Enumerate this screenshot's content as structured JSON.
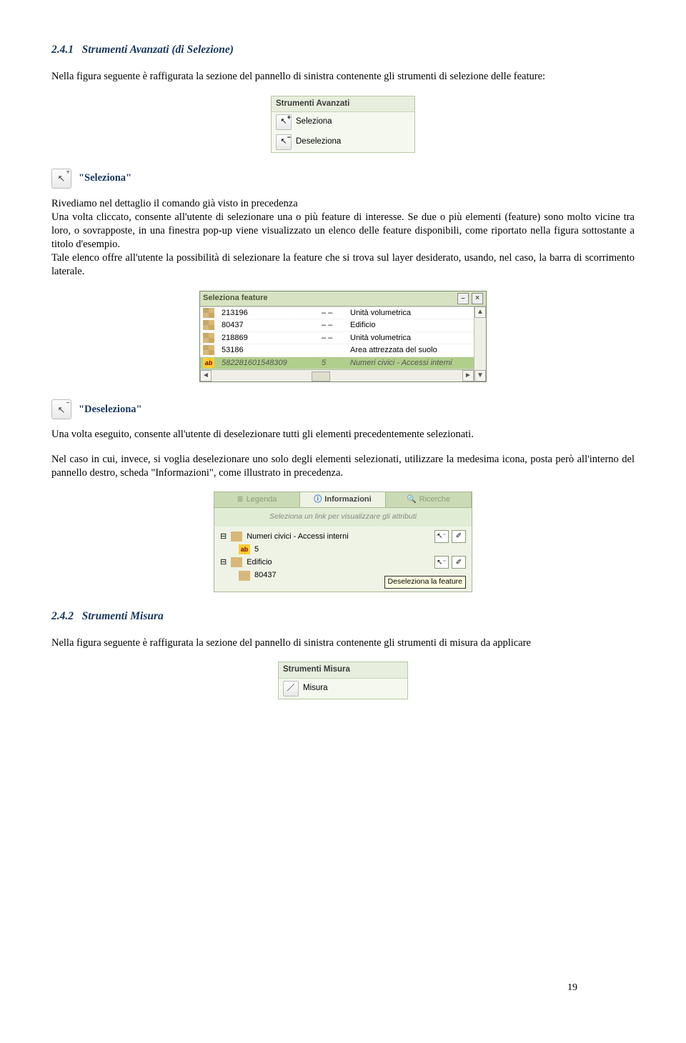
{
  "section1": {
    "number": "2.4.1",
    "title": "Strumenti Avanzati (di Selezione)"
  },
  "intro1": "Nella figura seguente è raffigurata la sezione del pannello di sinistra contenente gli strumenti di selezione delle feature:",
  "fig_avanzati": {
    "title": "Strumenti Avanzati",
    "opt1": "Seleziona",
    "opt2": "Deseleziona"
  },
  "tool_seleziona": {
    "label": "\"Seleziona\""
  },
  "para_sel1": "Rivediamo nel dettaglio il comando già visto in precedenza",
  "para_sel2": "Una volta cliccato, consente all'utente di selezionare una o più feature di interesse. Se due o più elementi (feature) sono molto vicine tra loro, o sovrapposte, in una finestra pop-up viene visualizzato un elenco delle feature disponibili, come riportato nella figura sottostante a titolo d'esempio.",
  "para_sel3": "Tale elenco offre all'utente la possibilità di selezionare la feature che si trova sul layer desiderato, usando, nel caso, la barra di scorrimento laterale.",
  "fig_popup": {
    "title": "Seleziona feature",
    "rows": [
      {
        "icon": "poly",
        "c1": "213196",
        "c2": "– –",
        "c3": "Unità volumetrica"
      },
      {
        "icon": "poly",
        "c1": "80437",
        "c2": "– –",
        "c3": "Edificio"
      },
      {
        "icon": "poly",
        "c1": "218869",
        "c2": "– –",
        "c3": "Unità volumetrica"
      },
      {
        "icon": "poly",
        "c1": "53186",
        "c2": "",
        "c3": "Area attrezzata del suolo"
      },
      {
        "icon": "ab",
        "c1": "582281601548309",
        "c2": "5",
        "c3": "Numeri civici - Accessi interni",
        "italic": true
      }
    ]
  },
  "tool_deseleziona": {
    "label": "\"Deseleziona\""
  },
  "para_des1": "Una volta eseguito, consente all'utente di deselezionare tutti gli elementi precedentemente selezionati.",
  "para_des2": "Nel caso in cui, invece, si voglia deselezionare uno solo degli elementi selezionati, utilizzare la medesima icona, posta però all'interno del pannello destro, scheda \"Informazioni\", come illustrato in precedenza.",
  "fig_tabs": {
    "tab1": "Legenda",
    "tab2": "Informazioni",
    "tab3": "Ricerche",
    "hint": "Seleziona un link per visualizzare gli attributi",
    "layer1": "Numeri civici - Accessi interni",
    "feat1": "5",
    "layer2": "Edificio",
    "feat2": "80437",
    "tooltip": "Deseleziona la feature"
  },
  "section2": {
    "number": "2.4.2",
    "title": "Strumenti Misura"
  },
  "intro2": "Nella figura seguente è raffigurata la sezione del pannello di sinistra contenente gli strumenti di misura da applicare",
  "fig_misura": {
    "title": "Strumenti Misura",
    "opt": "Misura"
  },
  "pagenum": "19"
}
